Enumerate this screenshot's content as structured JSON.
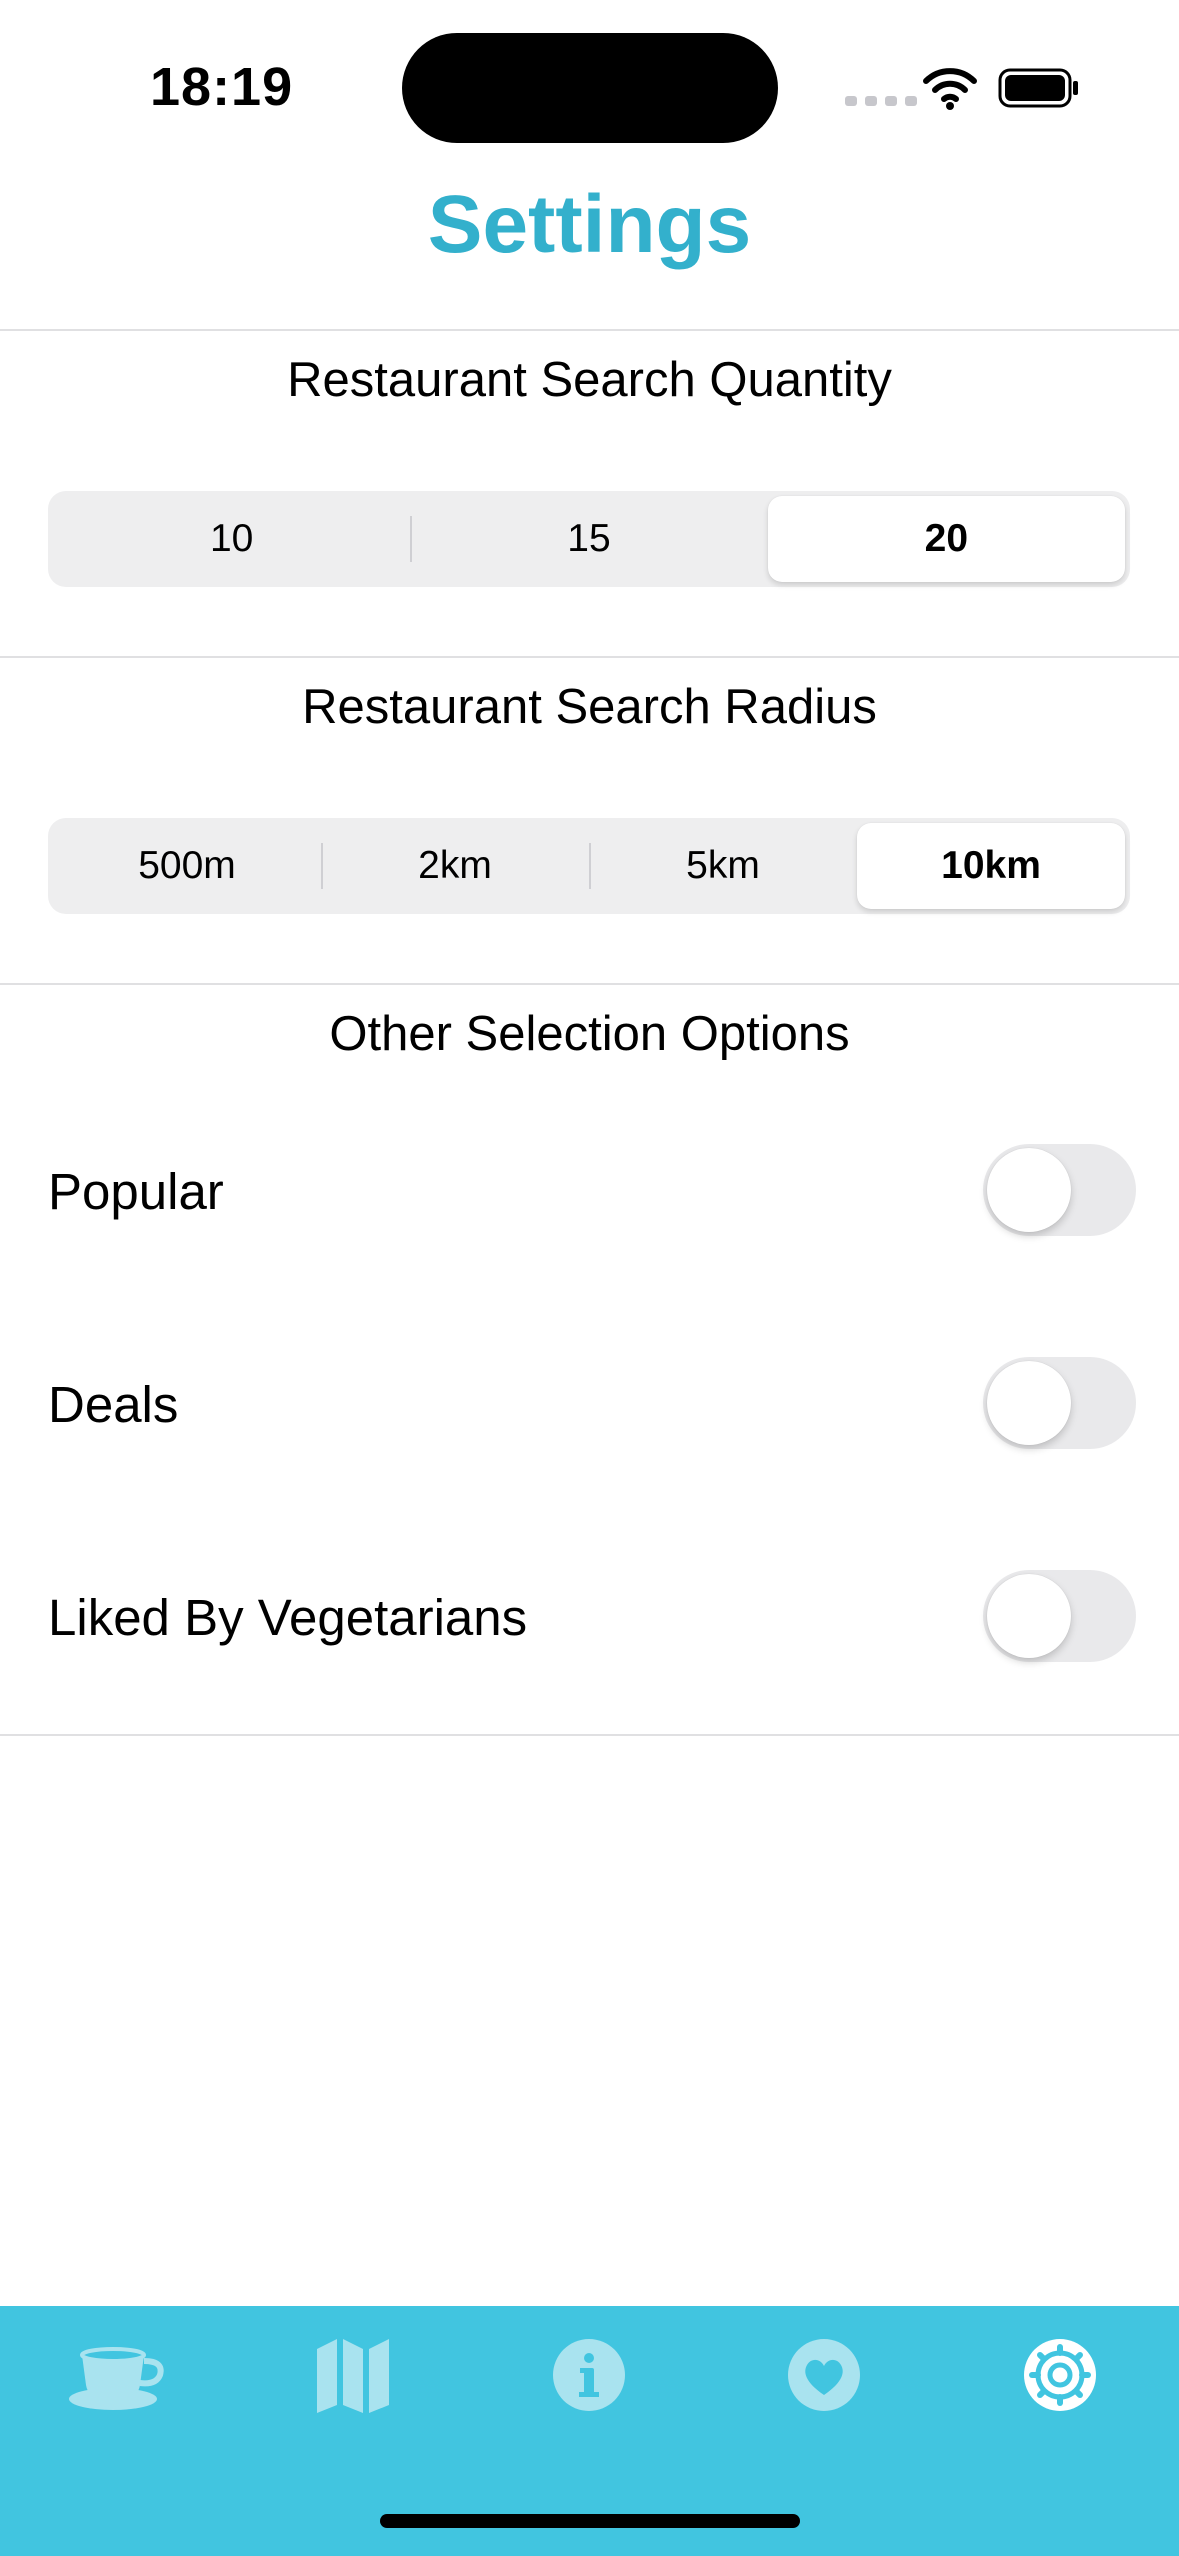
{
  "status_bar": {
    "time": "18:19"
  },
  "header": {
    "title": "Settings"
  },
  "quantity": {
    "title": "Restaurant Search Quantity",
    "options": [
      "10",
      "15",
      "20"
    ],
    "selected": "20"
  },
  "radius": {
    "title": "Restaurant Search Radius",
    "options": [
      "500m",
      "2km",
      "5km",
      "10km"
    ],
    "selected": "10km"
  },
  "other": {
    "title": "Other Selection Options",
    "items": [
      {
        "label": "Popular",
        "on": false
      },
      {
        "label": "Deals",
        "on": false
      },
      {
        "label": "Liked By Vegetarians",
        "on": false
      }
    ]
  },
  "tab_bar": {
    "tabs": [
      {
        "icon": "coffee-cup-icon",
        "selected": false
      },
      {
        "icon": "map-icon",
        "selected": false
      },
      {
        "icon": "info-icon",
        "selected": false
      },
      {
        "icon": "heart-icon",
        "selected": false
      },
      {
        "icon": "settings-gear-icon",
        "selected": true
      }
    ]
  },
  "colors": {
    "accent": "#33b0cc",
    "tab_bar": "#41c5e0",
    "tab_icon_inactive": "#a9e3ef"
  }
}
